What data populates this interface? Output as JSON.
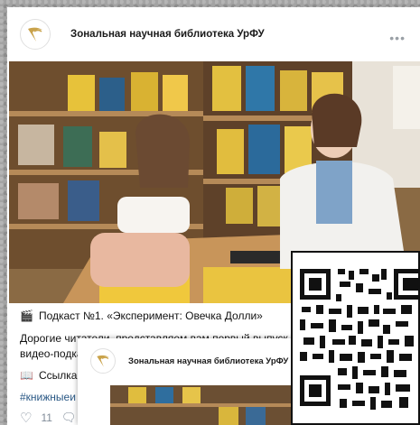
{
  "post": {
    "group_name": "Зональная научная библиотека УрФУ",
    "more_label": "•••",
    "title": "Подкаст №1. «Эксперимент: Овечка Долли»",
    "text": "Дорогие читатели, представляем вам первый выпуск",
    "text_line2": "видео-подка",
    "link_label": "Ссылка н",
    "hashtags": "#книжныеи",
    "likes": "11"
  },
  "embed": {
    "group_name": "Зональная научная библиотека УрФУ"
  },
  "colors": {
    "accent": "#2a5885",
    "icon_gray": "#818c99",
    "logo_gold": "#c9a24a"
  }
}
